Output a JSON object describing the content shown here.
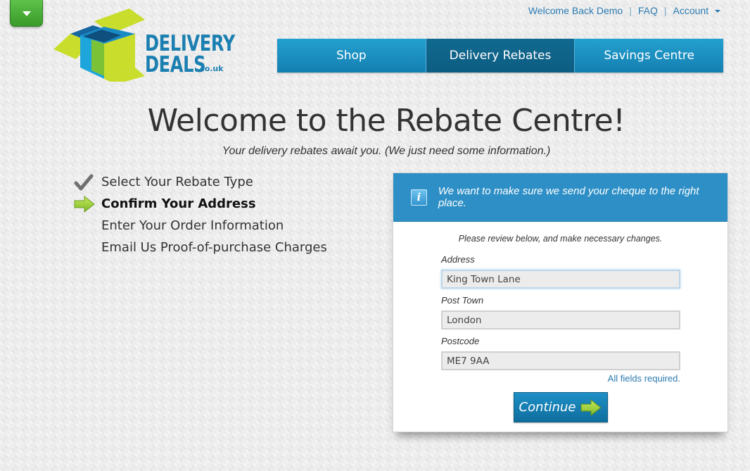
{
  "logo": {
    "line1": "DELIVERY",
    "line2": "DEALS",
    "suffix": ".co.uk"
  },
  "toplinks": {
    "welcome": "Welcome Back Demo",
    "faq": "FAQ",
    "account": "Account",
    "separator": "|"
  },
  "nav": {
    "items": [
      {
        "label": "Shop"
      },
      {
        "label": "Delivery Rebates"
      },
      {
        "label": "Savings Centre"
      }
    ],
    "active_index": 1
  },
  "page": {
    "title": "Welcome to the Rebate Centre!",
    "subtitle": "Your delivery rebates await you. (We just need some information.)"
  },
  "steps": [
    {
      "label": "Select Your Rebate Type",
      "status": "done"
    },
    {
      "label": "Confirm Your Address",
      "status": "current"
    },
    {
      "label": "Enter Your Order Information",
      "status": "pending"
    },
    {
      "label": "Email Us Proof-of-purchase Charges",
      "status": "pending"
    }
  ],
  "panel": {
    "header": "We want to make sure we send your cheque to the right place.",
    "info_icon": "i",
    "instructions": "Please review below, and make necessary changes.",
    "fields": {
      "address": {
        "label": "Address",
        "value": "King Town Lane"
      },
      "post_town": {
        "label": "Post Town",
        "value": "London"
      },
      "postcode": {
        "label": "Postcode",
        "value": "ME7 9AA"
      }
    },
    "required_note": "All fields required.",
    "continue_label": "Continue"
  },
  "colors": {
    "brand_blue": "#1b7fb1",
    "nav_blue": "#1a8ec4",
    "nav_active": "#0f6589",
    "panel_header": "#2d8fc6",
    "accent_green": "#8ccf2e"
  },
  "icons": {
    "dropdown": "chevron-down-icon",
    "done": "check-icon",
    "current": "arrow-right-icon",
    "info": "info-icon",
    "continue": "arrow-right-icon"
  }
}
